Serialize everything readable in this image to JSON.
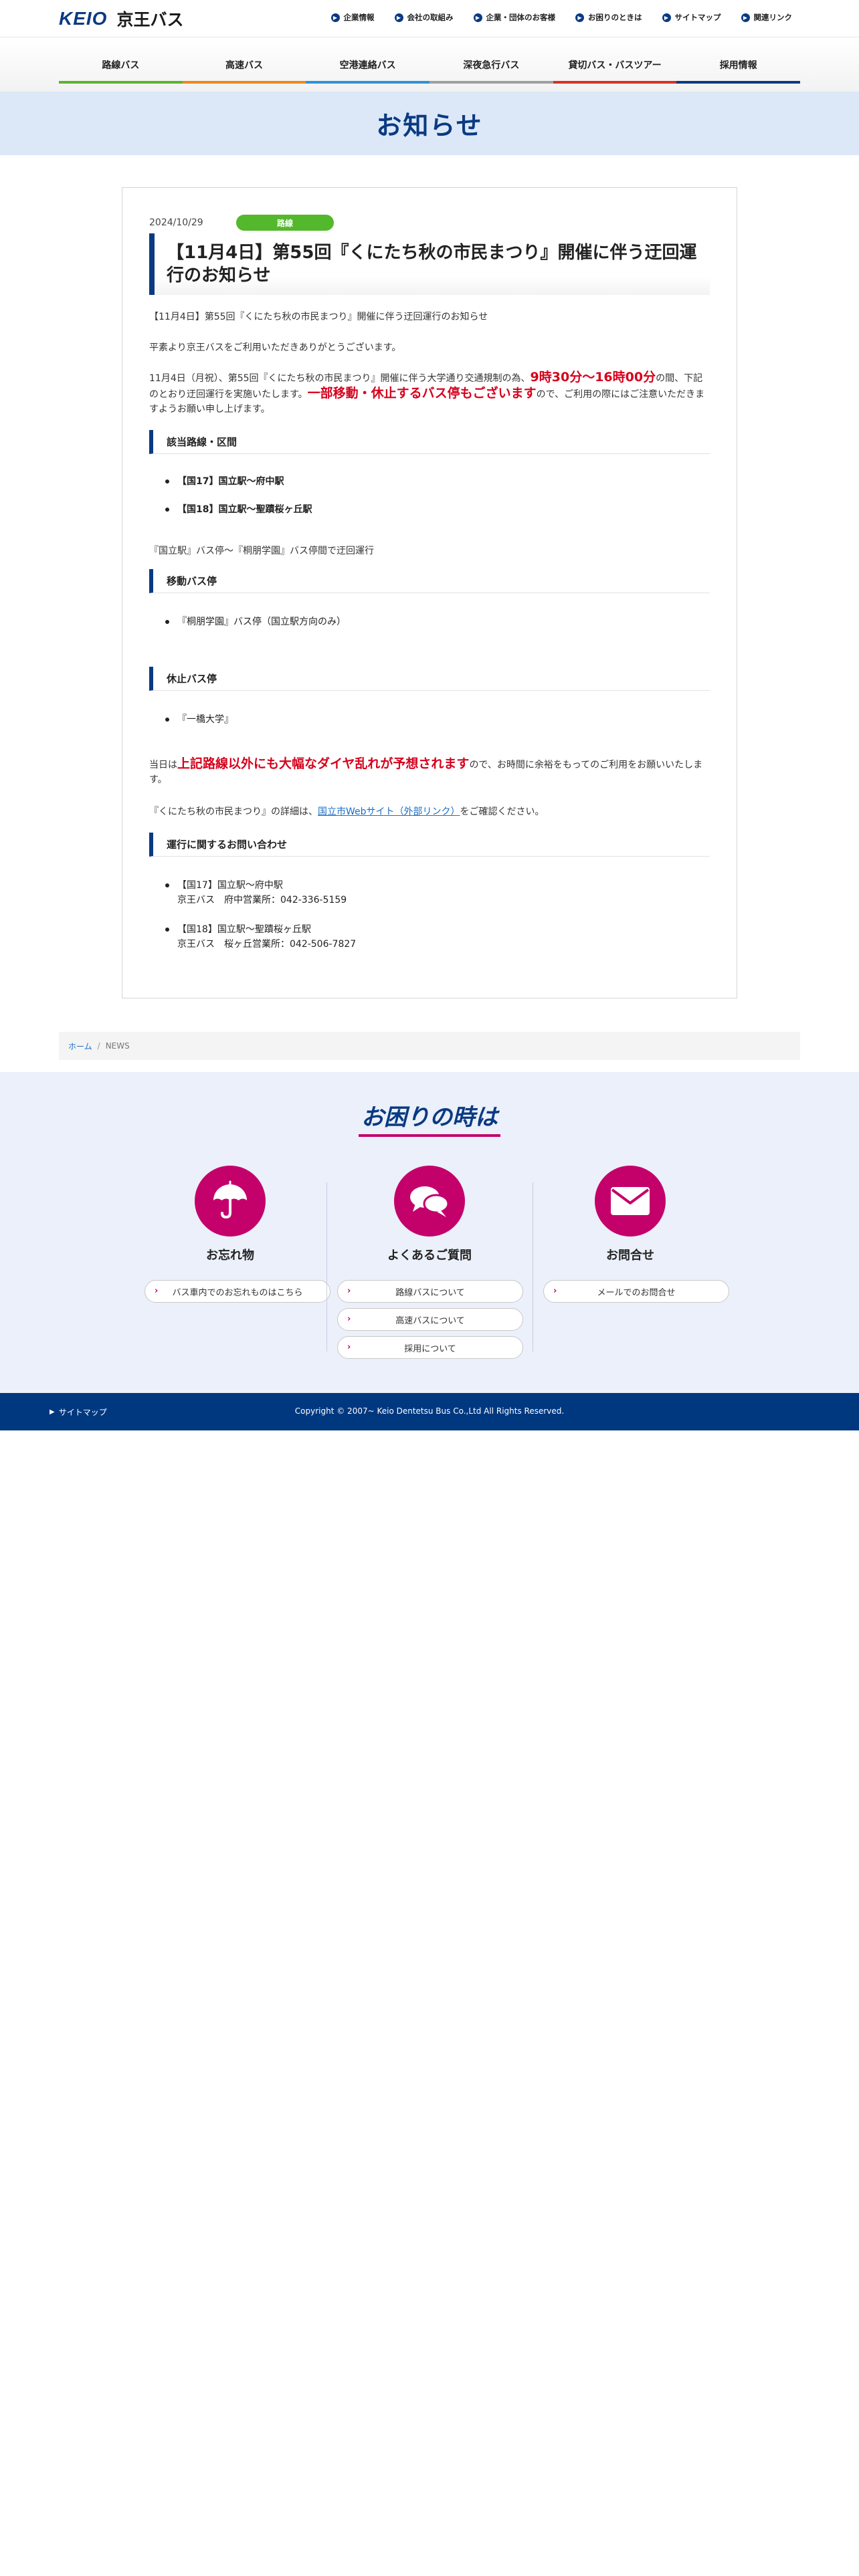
{
  "header": {
    "logo_brand": "KEIO",
    "logo_name": "京王バス",
    "util_links": [
      "企業情報",
      "会社の取組み",
      "企業・団体のお客様",
      "お困りのときは",
      "サイトマップ",
      "関連リンク"
    ]
  },
  "global_nav": {
    "items": [
      {
        "label": "路線バス",
        "color": "#5bb52c"
      },
      {
        "label": "高速バス",
        "color": "#ee8a1a"
      },
      {
        "label": "空港連絡バス",
        "color": "#2e94d6"
      },
      {
        "label": "深夜急行バス",
        "color": "#a0a0a0"
      },
      {
        "label": "貸切バス・バスツアー",
        "color": "#d8312a"
      },
      {
        "label": "採用情報",
        "color": "#0a3a82"
      }
    ]
  },
  "page_title": "お知らせ",
  "article": {
    "date": "2024/10/29",
    "category": "路線",
    "title": "【11月4日】第55回『くにたち秋の市民まつり』開催に伴う迂回運行のお知らせ",
    "intro": "【11月4日】第55回『くにたち秋の市民まつり』開催に伴う迂回運行のお知らせ",
    "greeting": "平素より京王バスをご利用いただきありがとうございます。",
    "notice_a": "11月4日（月祝）、第55回『くにたち秋の市民まつり』開催に伴う大学通り交通規制の為、",
    "notice_time": "9時30分～16時00分",
    "notice_b": "の間、下記のとおり迂回運行を実施いたします。",
    "notice_warning": "一部移動・休止するバス停もございます",
    "notice_c": "ので、ご利用の際にはご注意いただきますようお願い申し上げます。",
    "sec_routes": "該当路線・区間",
    "route_1": "【国17】国立駅～府中駅",
    "route_2": "【国18】国立駅～聖蹟桜ヶ丘駅",
    "detour_note": "『国立駅』バス停～『桐朋学園』バス停間で迂回運行",
    "sec_moved": "移動バス停",
    "moved_stop": "『桐朋学園』バス停（国立駅方向のみ）",
    "sec_suspended": "休止バス停",
    "suspended_stop": "『一橋大学』",
    "delay_a": "当日は",
    "delay_em": "上記路線以外にも大幅なダイヤ乱れが予想されます",
    "delay_b": "ので、お時間に余裕をもってのご利用をお願いいたします。",
    "festival_a": "『くにたち秋の市民まつり』の詳細は、",
    "festival_link": "国立市Webサイト（外部リンク）",
    "festival_b": "をご確認ください。",
    "sec_contact": "運行に関するお問い合わせ",
    "contact_1_route": "【国17】国立駅～府中駅",
    "contact_1_office": "京王バス　府中営業所：042-336-5159",
    "contact_2_route": "【国18】国立駅～聖蹟桜ヶ丘駅",
    "contact_2_office": "京王バス　桜ヶ丘営業所：042-506-7827"
  },
  "breadcrumb": {
    "home": "ホーム",
    "separator": "/",
    "current": "NEWS"
  },
  "help": {
    "title": "お困りの時は",
    "columns": [
      {
        "label": "お忘れ物",
        "icon": "umbrella-icon",
        "buttons": [
          "バス車内でのお忘れものはこちら"
        ]
      },
      {
        "label": "よくあるご質問",
        "icon": "speech-bubbles-icon",
        "buttons": [
          "路線バスについて",
          "高速バスについて",
          "採用について"
        ]
      },
      {
        "label": "お問合せ",
        "icon": "envelope-icon",
        "buttons": [
          "メールでのお問合せ"
        ]
      }
    ]
  },
  "footer": {
    "sitemap": "サイトマップ",
    "copyright": "Copyright © 2007~ Keio Dentetsu Bus Co.,Ltd All Rights Reserved."
  },
  "colors": {
    "brand_navy": "#0a3a82",
    "accent_magenta": "#c4006b",
    "alert_red": "#d6001c",
    "category_green": "#53b82b"
  }
}
